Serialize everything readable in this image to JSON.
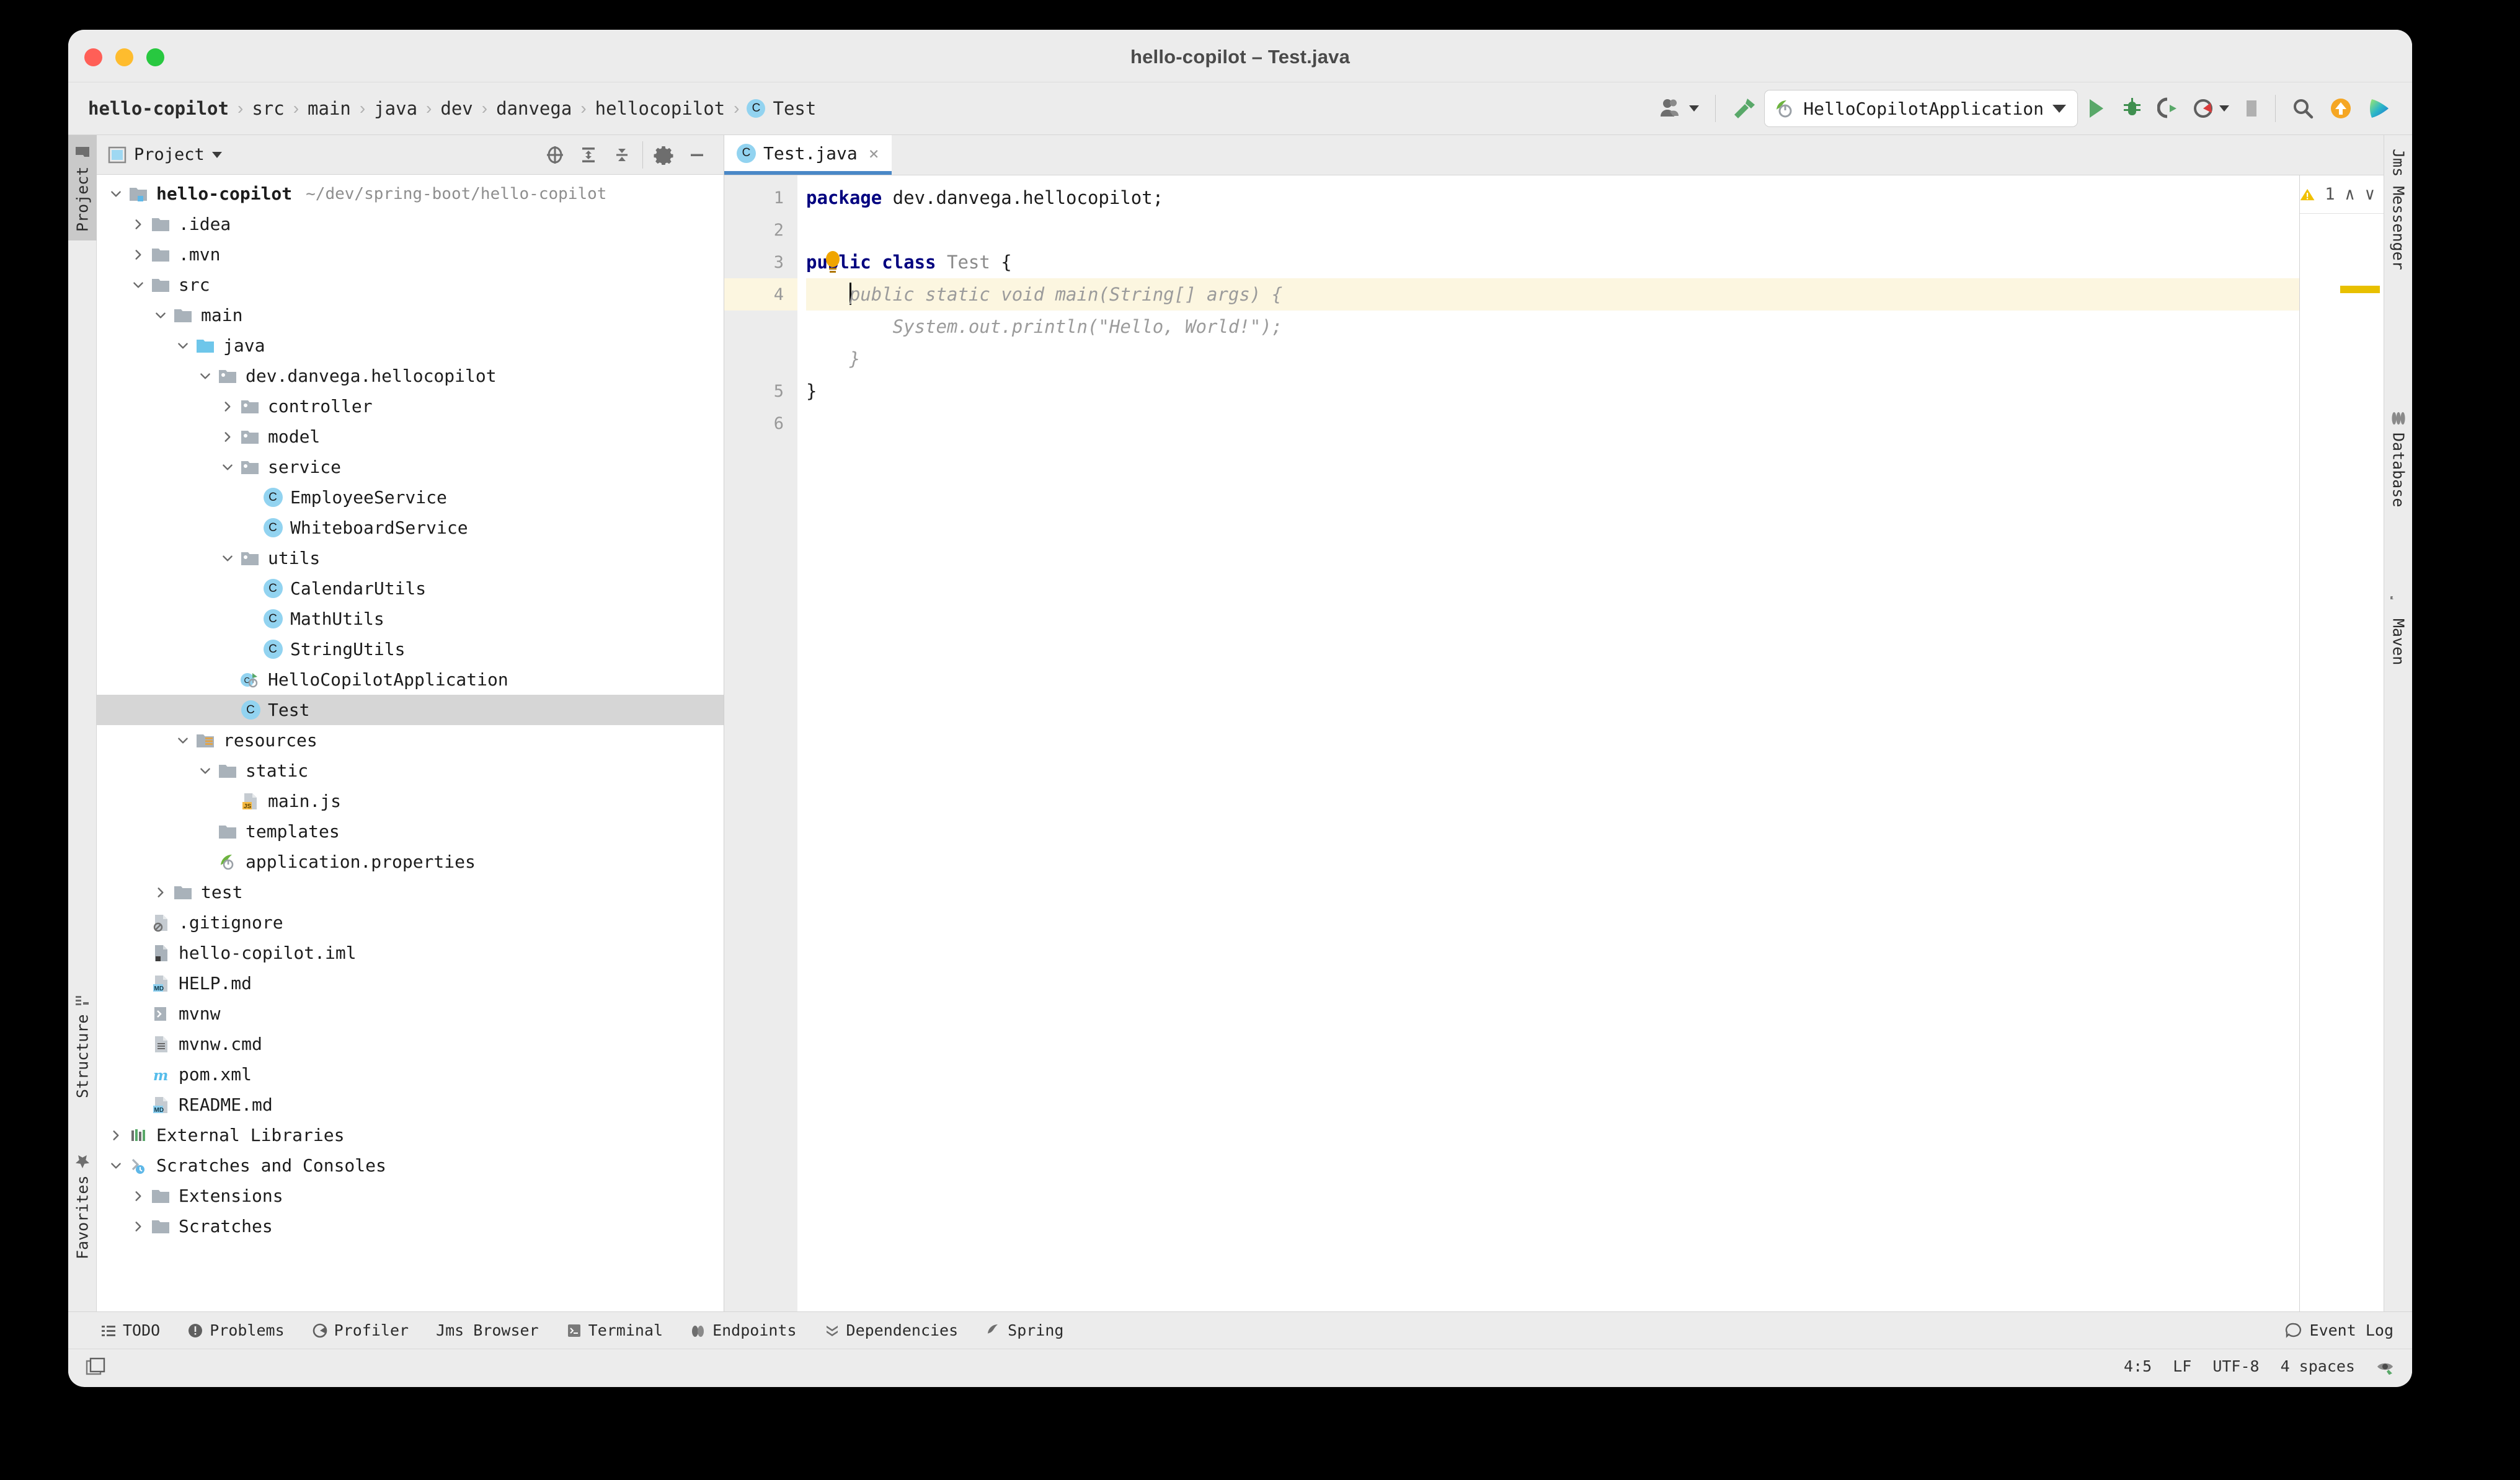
{
  "window": {
    "title": "hello-copilot – Test.java",
    "traffic_lights": [
      "close",
      "minimize",
      "zoom"
    ]
  },
  "breadcrumb": {
    "items": [
      {
        "label": "hello-copilot",
        "bold": true
      },
      {
        "label": "src",
        "bold": false
      },
      {
        "label": "main",
        "bold": false
      },
      {
        "label": "java",
        "bold": false
      },
      {
        "label": "dev",
        "bold": false
      },
      {
        "label": "danvega",
        "bold": false
      },
      {
        "label": "hellocopilot",
        "bold": false
      },
      {
        "label": "Test",
        "bold": false,
        "badge": "C"
      }
    ],
    "separator": "›"
  },
  "toolbar": {
    "account_icon": "user-account-icon",
    "build_icon": "build-hammer-icon",
    "run_config": {
      "icon": "spring-boot-icon",
      "label": "HelloCopilotApplication",
      "dropdown": "▾"
    },
    "run_icon": "run-play-icon",
    "debug_icon": "debug-bug-icon",
    "rerun_icon": "run-with-coverage-icon",
    "profile_icon": "profiler-icon",
    "stop_icon": "stop-icon",
    "search_icon": "search-icon",
    "update_icon": "update-available-icon",
    "copilot_icon": "copilot-icon"
  },
  "left_rail": {
    "tabs": [
      {
        "label": "Project",
        "icon": "project-icon",
        "active": true
      },
      {
        "label": "Structure",
        "icon": "structure-icon",
        "active": false
      },
      {
        "label": "Favorites",
        "icon": "favorites-star-icon",
        "active": false
      }
    ]
  },
  "right_rail": {
    "tabs": [
      {
        "label": "Jms Messenger",
        "icon": "jms-icon"
      },
      {
        "label": "Database",
        "icon": "database-icon"
      },
      {
        "label": "Maven",
        "icon": "maven-icon"
      }
    ]
  },
  "project_panel": {
    "title": "Project",
    "title_dropdown": "▾",
    "actions": [
      {
        "name": "select-opened-file-icon"
      },
      {
        "name": "expand-all-icon"
      },
      {
        "name": "collapse-all-icon"
      },
      {
        "name": "settings-gear-icon"
      },
      {
        "name": "hide-panel-icon"
      }
    ],
    "tree": [
      {
        "indent": 0,
        "arrow": "down",
        "icon": "module-folder",
        "label": "hello-copilot",
        "bold": true,
        "sub": "~/dev/spring-boot/hello-copilot"
      },
      {
        "indent": 1,
        "arrow": "right",
        "icon": "folder",
        "label": ".idea"
      },
      {
        "indent": 1,
        "arrow": "right",
        "icon": "folder",
        "label": ".mvn"
      },
      {
        "indent": 1,
        "arrow": "down",
        "icon": "folder",
        "label": "src"
      },
      {
        "indent": 2,
        "arrow": "down",
        "icon": "folder",
        "label": "main"
      },
      {
        "indent": 3,
        "arrow": "down",
        "icon": "source-folder",
        "label": "java"
      },
      {
        "indent": 4,
        "arrow": "down",
        "icon": "package",
        "label": "dev.danvega.hellocopilot"
      },
      {
        "indent": 5,
        "arrow": "right",
        "icon": "package",
        "label": "controller"
      },
      {
        "indent": 5,
        "arrow": "right",
        "icon": "package",
        "label": "model"
      },
      {
        "indent": 5,
        "arrow": "down",
        "icon": "package",
        "label": "service"
      },
      {
        "indent": 6,
        "arrow": "none",
        "icon": "java-class",
        "label": "EmployeeService"
      },
      {
        "indent": 6,
        "arrow": "none",
        "icon": "java-class",
        "label": "WhiteboardService"
      },
      {
        "indent": 5,
        "arrow": "down",
        "icon": "package",
        "label": "utils"
      },
      {
        "indent": 6,
        "arrow": "none",
        "icon": "java-class",
        "label": "CalendarUtils"
      },
      {
        "indent": 6,
        "arrow": "none",
        "icon": "java-class",
        "label": "MathUtils"
      },
      {
        "indent": 6,
        "arrow": "none",
        "icon": "java-class",
        "label": "StringUtils"
      },
      {
        "indent": 5,
        "arrow": "none",
        "icon": "spring-class",
        "label": "HelloCopilotApplication"
      },
      {
        "indent": 5,
        "arrow": "none",
        "icon": "java-class",
        "label": "Test",
        "selected": true
      },
      {
        "indent": 3,
        "arrow": "down",
        "icon": "resource-folder",
        "label": "resources"
      },
      {
        "indent": 4,
        "arrow": "down",
        "icon": "folder",
        "label": "static"
      },
      {
        "indent": 5,
        "arrow": "none",
        "icon": "js-file",
        "label": "main.js"
      },
      {
        "indent": 4,
        "arrow": "none",
        "icon": "folder",
        "label": "templates"
      },
      {
        "indent": 4,
        "arrow": "none",
        "icon": "spring-file",
        "label": "application.properties"
      },
      {
        "indent": 2,
        "arrow": "right",
        "icon": "folder",
        "label": "test"
      },
      {
        "indent": 1,
        "arrow": "none",
        "icon": "gitignore-file",
        "label": ".gitignore"
      },
      {
        "indent": 1,
        "arrow": "none",
        "icon": "iml-file",
        "label": "hello-copilot.iml"
      },
      {
        "indent": 1,
        "arrow": "none",
        "icon": "md-file",
        "label": "HELP.md"
      },
      {
        "indent": 1,
        "arrow": "none",
        "icon": "shell-file",
        "label": "mvnw"
      },
      {
        "indent": 1,
        "arrow": "none",
        "icon": "text-file",
        "label": "mvnw.cmd"
      },
      {
        "indent": 1,
        "arrow": "none",
        "icon": "maven-file",
        "label": "pom.xml"
      },
      {
        "indent": 1,
        "arrow": "none",
        "icon": "md-file",
        "label": "README.md"
      },
      {
        "indent": 0,
        "arrow": "right",
        "icon": "libraries",
        "label": "External Libraries"
      },
      {
        "indent": 0,
        "arrow": "down",
        "icon": "scratches",
        "label": "Scratches and Consoles"
      },
      {
        "indent": 1,
        "arrow": "right",
        "icon": "folder",
        "label": "Extensions"
      },
      {
        "indent": 1,
        "arrow": "right",
        "icon": "folder",
        "label": "Scratches"
      }
    ]
  },
  "editor": {
    "tabs": [
      {
        "label": "Test.java",
        "icon": "java-class",
        "close": "×",
        "active": true
      }
    ],
    "gutter_lines": [
      "1",
      "2",
      "3",
      "4",
      "",
      "",
      "5",
      "6"
    ],
    "highlight_line_index": 3,
    "inspection": {
      "warning_icon": "warning-triangle-icon",
      "count": "1",
      "prev": "∧",
      "next": "∨"
    },
    "lines": [
      {
        "n": "1",
        "tokens": [
          {
            "t": "package",
            "c": "kw"
          },
          {
            "t": " dev.danvega.hellocopilot;",
            "c": ""
          }
        ]
      },
      {
        "n": "2",
        "tokens": []
      },
      {
        "n": "3",
        "tokens": [
          {
            "t": "public class",
            "c": "kw"
          },
          {
            "t": " ",
            "c": ""
          },
          {
            "t": "Test",
            "c": "cname"
          },
          {
            "t": " {",
            "c": ""
          }
        ],
        "bulb": true
      },
      {
        "n": "4",
        "tokens": [
          {
            "t": "    ",
            "c": ""
          },
          {
            "t": "public static void main(String[] args) {",
            "c": "ghost"
          }
        ],
        "caret": true,
        "highlight": true
      },
      {
        "n": "",
        "tokens": [
          {
            "t": "        System.out.println(\"Hello, World!\");",
            "c": "ghost"
          }
        ]
      },
      {
        "n": "",
        "tokens": [
          {
            "t": "    }",
            "c": "ghost"
          }
        ]
      },
      {
        "n": "5",
        "tokens": [
          {
            "t": "}",
            "c": ""
          }
        ]
      },
      {
        "n": "6",
        "tokens": []
      }
    ]
  },
  "tool_windows": {
    "items": [
      {
        "label": "TODO",
        "icon": "todo-icon"
      },
      {
        "label": "Problems",
        "icon": "problems-icon"
      },
      {
        "label": "Profiler",
        "icon": "profiler-icon"
      },
      {
        "label": "Jms Browser",
        "icon": "jms-browser-icon"
      },
      {
        "label": "Terminal",
        "icon": "terminal-icon"
      },
      {
        "label": "Endpoints",
        "icon": "endpoints-icon"
      },
      {
        "label": "Dependencies",
        "icon": "dependencies-icon"
      },
      {
        "label": "Spring",
        "icon": "spring-icon"
      }
    ],
    "event_log": {
      "label": "Event Log",
      "icon": "event-log-icon"
    }
  },
  "status_bar": {
    "left_icon": "toggle-toolwindows-icon",
    "caret_position": "4:5",
    "line_separator": "LF",
    "encoding": "UTF-8",
    "indent": "4 spaces",
    "inspection_widget": "inspections-eye-icon"
  },
  "colors": {
    "accent": "#4a88c7",
    "window_bg": "#ececec",
    "editor_bg": "#ffffff",
    "keyword": "#00007f",
    "ghost_text": "#9b9b9b",
    "selection": "#d6d6d6",
    "highlight_line": "#fcf6e0",
    "warning": "#e8c000",
    "class_badge": "#92d3f0",
    "spring_green": "#6db33f",
    "update_orange": "#f5a623"
  }
}
